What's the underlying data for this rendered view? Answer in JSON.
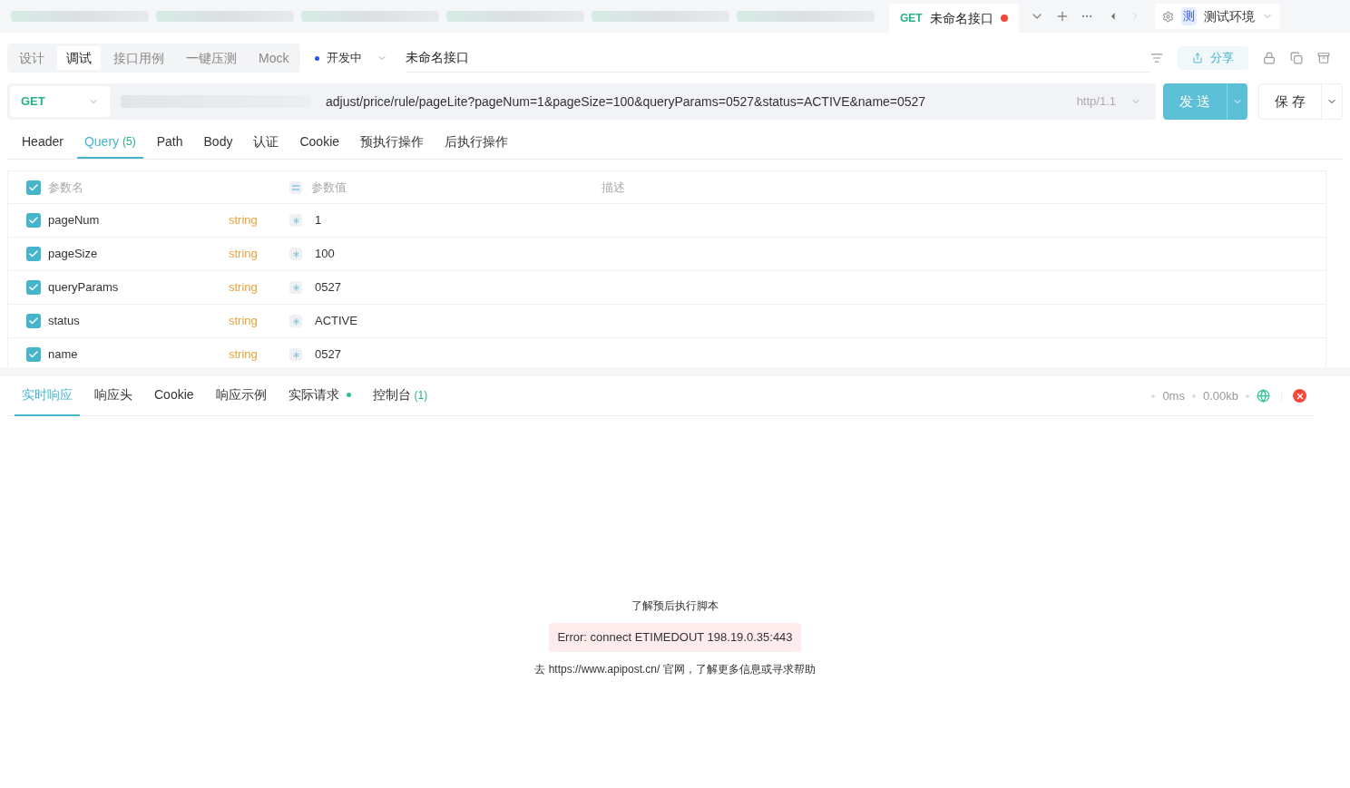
{
  "top_tabs": {
    "active": {
      "method": "GET",
      "title": "未命名接口",
      "unsaved": true
    }
  },
  "environment": {
    "badge": "测",
    "name": "测试环境"
  },
  "mode_tabs": [
    {
      "label": "设计",
      "selected": false
    },
    {
      "label": "调试",
      "selected": true
    },
    {
      "label": "接口用例",
      "selected": false
    },
    {
      "label": "一键压测",
      "selected": false
    },
    {
      "label": "Mock",
      "selected": false
    }
  ],
  "status": {
    "label": "开发中",
    "color": "#2f54eb"
  },
  "api_name": "未命名接口",
  "share": "分享",
  "request": {
    "method": "GET",
    "url": "adjust/price/rule/pageLite?pageNum=1&pageSize=100&queryParams=0527&status=ACTIVE&name=0527",
    "protocol": "http/1.1",
    "send": "发 送",
    "save": "保 存"
  },
  "request_tabs": [
    {
      "label": "Header",
      "selected": false
    },
    {
      "label": "Query",
      "count": "(5)",
      "selected": true
    },
    {
      "label": "Path",
      "selected": false
    },
    {
      "label": "Body",
      "selected": false
    },
    {
      "label": "认证",
      "selected": false
    },
    {
      "label": "Cookie",
      "selected": false
    },
    {
      "label": "预执行操作",
      "selected": false
    },
    {
      "label": "后执行操作",
      "selected": false
    }
  ],
  "params": {
    "columns": [
      "参数名",
      "参数值",
      "描述"
    ],
    "all_checked": true,
    "rows": [
      {
        "name": "pageNum",
        "type": "string",
        "value": "1",
        "checked": true
      },
      {
        "name": "pageSize",
        "type": "string",
        "value": "100",
        "checked": true
      },
      {
        "name": "queryParams",
        "type": "string",
        "value": "0527",
        "checked": true
      },
      {
        "name": "status",
        "type": "string",
        "value": "ACTIVE",
        "checked": true
      },
      {
        "name": "name",
        "type": "string",
        "value": "0527",
        "checked": true
      }
    ]
  },
  "response_tabs": [
    {
      "label": "实时响应",
      "selected": true
    },
    {
      "label": "响应头",
      "selected": false
    },
    {
      "label": "Cookie",
      "selected": false
    },
    {
      "label": "响应示例",
      "selected": false
    },
    {
      "label": "实际请求",
      "dot": true,
      "selected": false
    },
    {
      "label": "控制台",
      "count": "(1)",
      "selected": false
    }
  ],
  "response_stats": {
    "time": "0ms",
    "size": "0.00kb"
  },
  "response_body": {
    "hint": "了解预后执行脚本",
    "error": "Error: connect ETIMEDOUT 198.19.0.35:443",
    "help_prefix": "去 ",
    "help_link": "https://www.apipost.cn/",
    "help_suffix": " 官网，了解更多信息或寻求帮助"
  }
}
